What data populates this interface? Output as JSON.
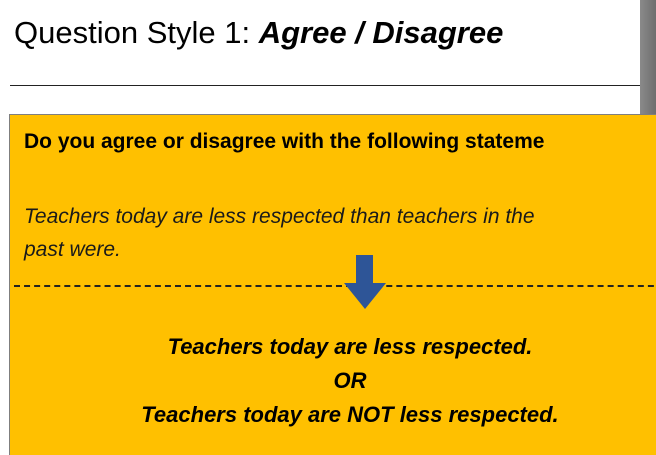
{
  "slide": {
    "title_prefix": "Question Style 1: ",
    "title_emphasis": "Agree / Disagree",
    "question": "Do you agree or disagree with the following stateme",
    "statement_line1": "Teachers today are less respected than teachers in the",
    "statement_line2": "past were.",
    "option_1": "Teachers today are less respected.",
    "or_label": "OR",
    "option_2": "Teachers today are NOT less respected."
  },
  "colors": {
    "box_background": "#ffc000",
    "arrow": "#2e5597"
  },
  "icons": {
    "arrow": "arrow-down-icon"
  }
}
